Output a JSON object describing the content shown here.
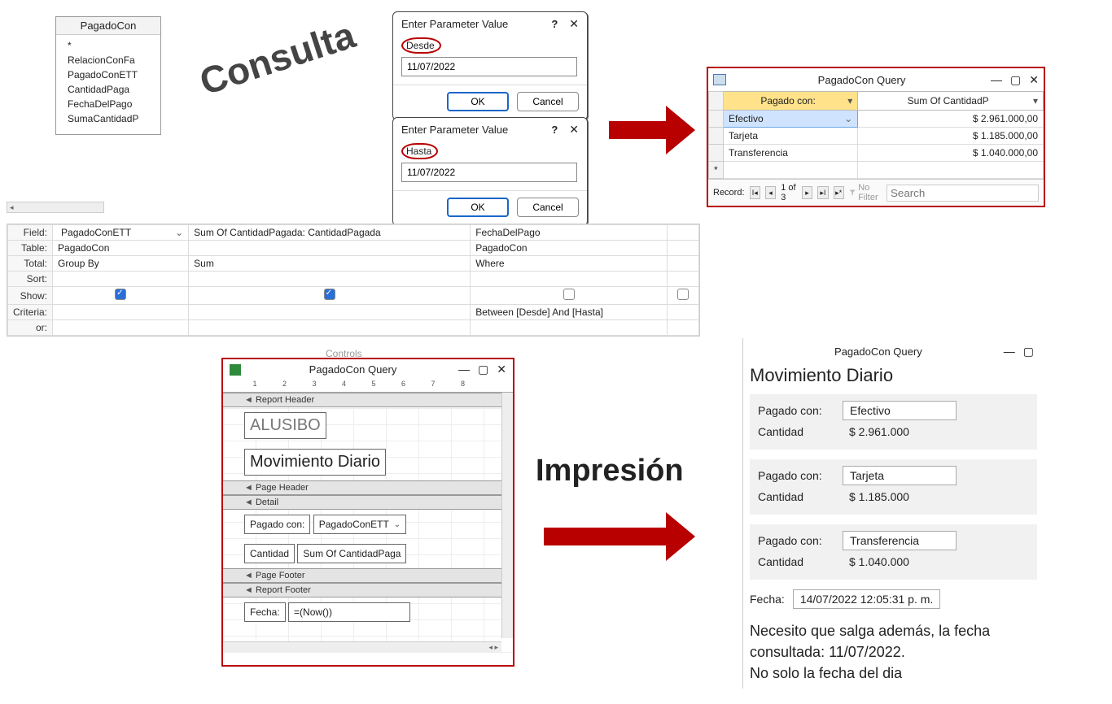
{
  "fieldlist": {
    "title": "PagadoCon",
    "items": [
      "*",
      "RelacionConFa",
      "PagadoConETT",
      "CantidadPaga",
      "FechaDelPago",
      "SumaCantidadP"
    ]
  },
  "consulta_label": "Consulta",
  "param1": {
    "title": "Enter Parameter Value",
    "label": "Desde",
    "value": "11/07/2022",
    "ok": "OK",
    "cancel": "Cancel"
  },
  "param2": {
    "title": "Enter Parameter Value",
    "label": "Hasta",
    "value": "11/07/2022",
    "ok": "OK",
    "cancel": "Cancel"
  },
  "query_result": {
    "title": "PagadoCon Query",
    "headers": [
      "Pagado con:",
      "Sum Of CantidadP"
    ],
    "rows": [
      {
        "name": "Efectivo",
        "amount": "$ 2.961.000,00",
        "selected": true
      },
      {
        "name": "Tarjeta",
        "amount": "$ 1.185.000,00"
      },
      {
        "name": "Transferencia",
        "amount": "$ 1.040.000,00"
      }
    ],
    "record_label": "Record:",
    "record_pos": "1 of 3",
    "no_filter": "No Filter",
    "search_placeholder": "Search"
  },
  "qbe": {
    "labels": {
      "field": "Field:",
      "table": "Table:",
      "total": "Total:",
      "sort": "Sort:",
      "show": "Show:",
      "criteria": "Criteria:",
      "or": "or:"
    },
    "cols": [
      {
        "field": "PagadoConETT",
        "table": "PagadoCon",
        "total": "Group By",
        "show": true,
        "criteria": "",
        "selected": true
      },
      {
        "field": "Sum Of CantidadPagada: CantidadPagada",
        "table": "",
        "total": "Sum",
        "show": true,
        "criteria": ""
      },
      {
        "field": "FechaDelPago",
        "table": "PagadoCon",
        "total": "Where",
        "show": false,
        "criteria": "Between [Desde] And [Hasta]"
      },
      {
        "field": "",
        "table": "",
        "total": "",
        "show": false,
        "criteria": ""
      }
    ]
  },
  "controls_cut": "Controls",
  "report_design": {
    "title": "PagadoCon Query",
    "ruler": " 1   2   3   4   5   6   7   8",
    "sections": {
      "rh": "Report Header",
      "ph": "Page Header",
      "d": "Detail",
      "pf": "Page Footer",
      "rf": "Report Footer"
    },
    "alusibo": "ALUSIBO",
    "mov": "Movimiento Diario",
    "pagado_lbl": "Pagado con:",
    "pagado_ctl": "PagadoConETT",
    "cantidad_lbl": "Cantidad",
    "cantidad_ctl": "Sum Of CantidadPaga",
    "fecha_lbl": "Fecha:",
    "fecha_ctl": "=(Now())"
  },
  "impresion": "Impresión",
  "preview": {
    "title": "PagadoCon Query",
    "heading": "Movimiento Diario",
    "label_pagado": "Pagado con:",
    "label_cantidad": "Cantidad",
    "blocks": [
      {
        "name": "Efectivo",
        "amount": "$ 2.961.000"
      },
      {
        "name": "Tarjeta",
        "amount": "$ 1.185.000"
      },
      {
        "name": "Transferencia",
        "amount": "$ 1.040.000"
      }
    ],
    "fecha_label": "Fecha:",
    "fecha_value": "14/07/2022 12:05:31 p. m.",
    "note_l1": "Necesito que salga además, la fecha",
    "note_l2": "consultada: 11/07/2022.",
    "note_l3": "No solo la fecha del dia"
  }
}
